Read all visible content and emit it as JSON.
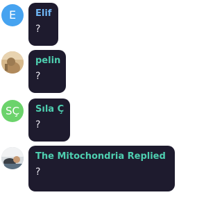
{
  "messages": [
    {
      "author": "Elif",
      "avatar_initials": "E",
      "avatar_color": "#46a3f0",
      "name_color": "#6fb6f5",
      "text": "?"
    },
    {
      "author": "pelin",
      "avatar_icon": "photo-avatar",
      "name_color": "#4ecfb0",
      "text": "?"
    },
    {
      "author": "Sıla Ç",
      "avatar_initials": "SÇ",
      "avatar_color": "#6bd36b",
      "name_color": "#4ecfb0",
      "text": "?"
    },
    {
      "author": "The Mitochondria Replied",
      "avatar_icon": "photo-avatar",
      "name_color": "#4ecfb0",
      "text": "?"
    }
  ]
}
